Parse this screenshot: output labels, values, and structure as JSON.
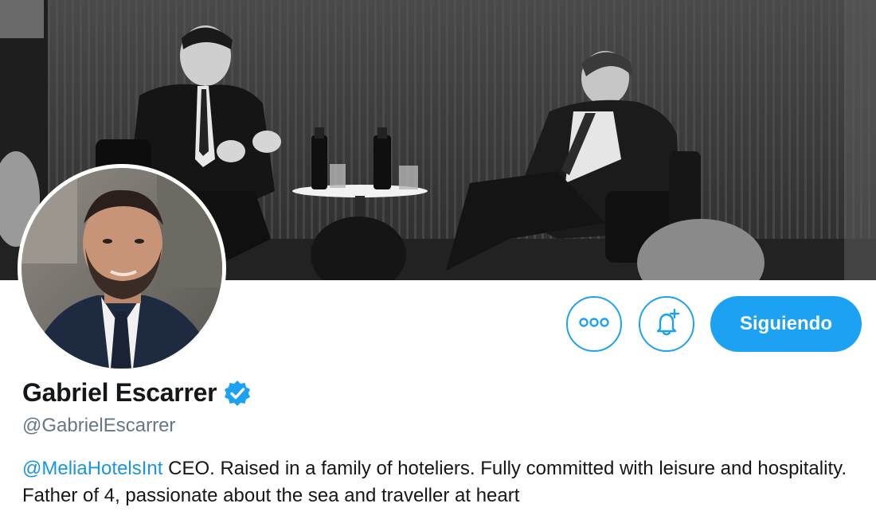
{
  "profile": {
    "display_name": "Gabriel Escarrer",
    "handle": "@GabrielEscarrer",
    "bio_mention": "@MeliaHotelsInt",
    "bio_text": " CEO. Raised in a family of hoteliers. Fully committed with leisure and hospitality. Father of 4, passionate about the sea and traveller at heart",
    "verified": true
  },
  "actions": {
    "more_icon": "more-dots-icon",
    "notify_icon": "bell-plus-icon",
    "follow_label": "Siguiendo"
  },
  "colors": {
    "accent": "#1da1f2",
    "link": "#1b95e0",
    "text_primary": "#14171a",
    "text_secondary": "#657786"
  }
}
